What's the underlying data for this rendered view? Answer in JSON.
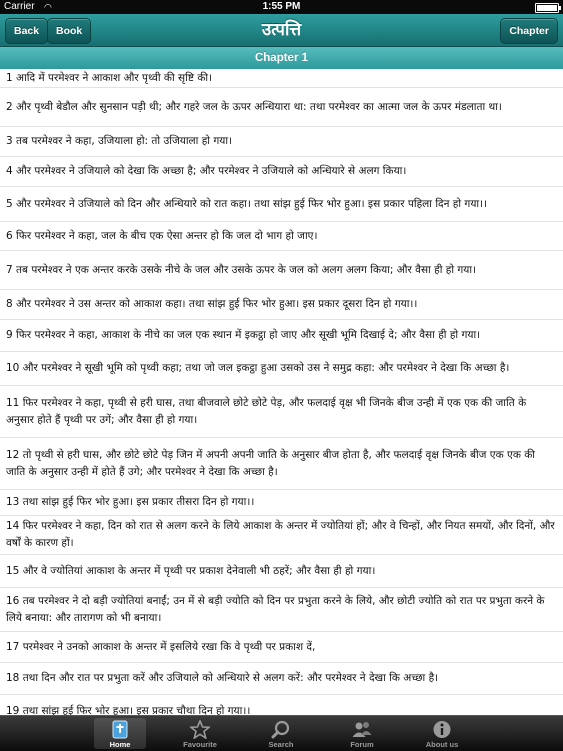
{
  "status_bar": {
    "carrier": "Carrier",
    "time": "1:55 PM",
    "battery_level": 0.9
  },
  "nav": {
    "title": "उत्पत्ति",
    "back_label": "Back",
    "book_label": "Book",
    "chapter_label": "Chapter"
  },
  "chapter_header": "Chapter 1",
  "verses": [
    "1  आदि में परमेश्वर ने आकाश और पृथ्वी की सृष्टि की।",
    "2  और पृथ्वी बेडौल और सुनसान पड़ी थी; और गहरे जल के ऊपर अन्धियारा था: तथा परमेश्वर का आत्मा जल के ऊपर मंडलाता था।",
    "3  तब परमेश्वर ने कहा, उजियाला हो: तो उजियाला हो गया।",
    "4  और परमेश्वर ने उजियाले को देखा कि अच्छा है; और परमेश्वर ने उजियाले को अन्धियारे से अलग किया।",
    "5  और परमेश्वर ने उजियाले को दिन और अन्धियारे को रात कहा। तथा सांझ हुई फिर भोर हुआ। इस प्रकार पहिला दिन हो गया।।",
    "6  फिर परमेश्वर ने कहा, जल के बीच एक ऐसा अन्तर हो कि जल दो भाग हो जाए।",
    "7   तब परमेश्वर ने एक अन्तर करके उसके नीचे के जल और उसके ऊपर के जल को अलग अलग किया; और वैसा ही हो गया।",
    "8  और परमेश्वर ने उस अन्तर को आकाश कहा। तथा सांझ हुई फिर भोर हुआ। इस प्रकार दूसरा दिन हो गया।।",
    "9  फिर परमेश्वर ने कहा, आकाश के नीचे का जल एक स्थान में इकट्ठा हो जाए और सूखी भूमि दिखाई दे; और वैसा ही हो गया।",
    "10  और परमेश्वर ने सूखी भूमि को पृथ्वी कहा; तथा जो जल इकट्ठा हुआ उसको उस ने समुद्र कहा: और परमेश्वर ने देखा कि अच्छा है।",
    "11  फिर परमेश्वर ने कहा, पृथ्वी से हरी घास, तथा बीजवाले छोटे छोटे पेड़, और फलदाई वृक्ष भी जिनके बीज उन्ही में एक एक की जाति के अनुसार होते हैं पृथ्वी पर उगें; और वैसा ही हो गया।",
    "12  तो पृथ्वी से हरी घास, और छोटे छोटे पेड़ जिन में अपनी अपनी जाति के अनुसार बीज होता है, और फलदाई वृक्ष जिनके बीज एक एक की जाति के अनुसार उन्ही में होते हैं उगे; और परमेश्वर ने देखा कि अच्छा है।",
    "13  तथा सांझ हुई फिर भोर हुआ। इस प्रकार तीसरा दिन हो गया।।",
    "14  फिर परमेश्वर ने कहा, दिन को रात से अलग करने के लिये आकाश के अन्तर में ज्योतियां हों; और वे चिन्हों, और नियत समयों, और दिनों, और वर्षों के कारण हों।",
    "15  और वे ज्योतियां आकाश के अन्तर में पृथ्वी पर प्रकाश देनेवाली भी ठहरें; और वैसा ही हो गया।",
    "16  तब परमेश्वर ने दो बड़ी ज्योतियां बनाईं; उन में से बड़ी ज्योति को दिन पर प्रभुता करने के लिये, और छोटी ज्योति को रात पर प्रभुता करने के लिये बनाया: और तारागण को भी बनाया।",
    "17   परमेश्वर ने उनको आकाश के अन्तर में इसलिये रखा कि वे पृथ्वी पर प्रकाश दें,",
    "18  तथा दिन और रात पर प्रभुता करें और उजियाले को अन्धियारे से अलग करें: और परमेश्वर ने देखा कि अच्छा है।",
    "19  तथा सांझ हुई फिर भोर हुआ। इस प्रकार चौथा दिन हो गया।।"
  ],
  "tabs": [
    {
      "label": "Home",
      "icon": "book-icon",
      "active": true
    },
    {
      "label": "Favourite",
      "icon": "star-icon",
      "active": false
    },
    {
      "label": "Search",
      "icon": "magnifier-icon",
      "active": false
    },
    {
      "label": "Forum",
      "icon": "people-icon",
      "active": false
    },
    {
      "label": "About us",
      "icon": "info-icon",
      "active": false
    }
  ],
  "colors": {
    "nav_bar": "#1f8485",
    "chapter_header": "#3aa8a9",
    "tab_bar": "#1a1a1a"
  }
}
